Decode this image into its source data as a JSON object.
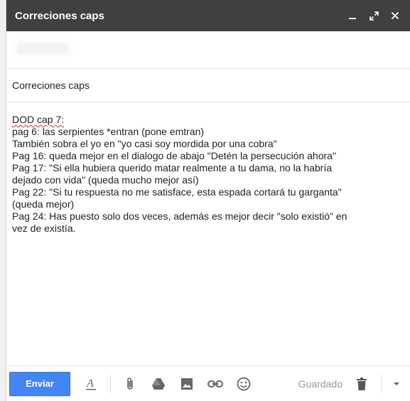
{
  "window": {
    "title": "Correciones caps"
  },
  "subject": {
    "value": "Correciones caps"
  },
  "body": {
    "lines": [
      "DOD cap 7:",
      "pag 6: las serpientes *entran (pone emtran)",
      "También sobra el yo en \"yo casi soy mordida por una cobra\"",
      "Pag 16: queda mejor en el dialogo de abajo \"Detén la persecución ahora\"",
      "Pag 17: \"Si ella hubiera querido matar realmente a tu dama, no la habría",
      "dejado con vida\" (queda mucho mejor así)",
      "Pag 22: \"Si tu respuesta no me satisface, esta espada cortará tu garganta\"",
      "(queda mejor)",
      "Pag 24: Has puesto solo dos veces, además es mejor decir \"solo existió\" en",
      "vez de existía."
    ]
  },
  "toolbar": {
    "send_label": "Enviar",
    "saved_label": "Guardado",
    "icons": [
      "formatting-icon",
      "attach-icon",
      "drive-icon",
      "photo-icon",
      "link-icon",
      "emoji-icon",
      "trash-icon",
      "more-options-icon"
    ]
  },
  "colors": {
    "titlebar": "#404040",
    "send_button": "#4285f4"
  }
}
